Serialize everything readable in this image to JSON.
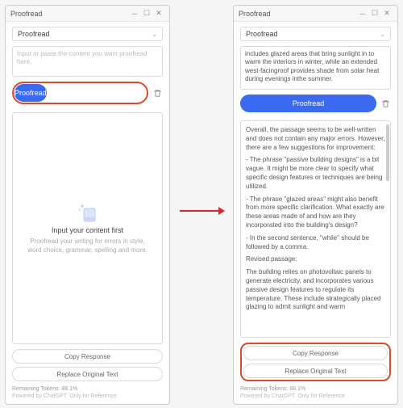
{
  "window": {
    "title": "Proofread"
  },
  "dropdown": {
    "selected": "Proofread"
  },
  "left": {
    "placeholder": "Input or paste the content you want proofread here.",
    "empty_title": "Input your content first",
    "empty_sub": "Proofread your writing for errors in style, word choice, grammar, spelling and more."
  },
  "right": {
    "input_text": "includes glazed areas\nthat bring sunlight in to warm the interiors in winter, while an extended west-facingroof provides shade from solar heat during evenings\ninthe summer.",
    "output_lines": [
      "Overall, the passage seems to be well-written and does not contain any major errors. However, there are a few suggestions for improvement:",
      "- The phrase \"passive building designs\" is a bit vague. It might be more clear to specify what specific design features or techniques are being utilized.",
      "- The phrase \"glazed areas\" might also benefit from more specific clarification. What exactly are these areas made of and how are they incorporated into the building's design?",
      "- In the second sentence, \"while\" should be followed by a comma.",
      "Revised passage:",
      "The building relies on photovoltaic panels to generate electricity, and incorporates various passive design features to regulate its temperature. These include strategically placed glazing to admit sunlight and warm"
    ]
  },
  "buttons": {
    "primary": "Proofread",
    "copy": "Copy Response",
    "replace": "Replace Original Text"
  },
  "footer": {
    "tokens": "Remaining Tokens: 88.1%",
    "powered": "Powered by ChatGPT. Only for Reference"
  }
}
